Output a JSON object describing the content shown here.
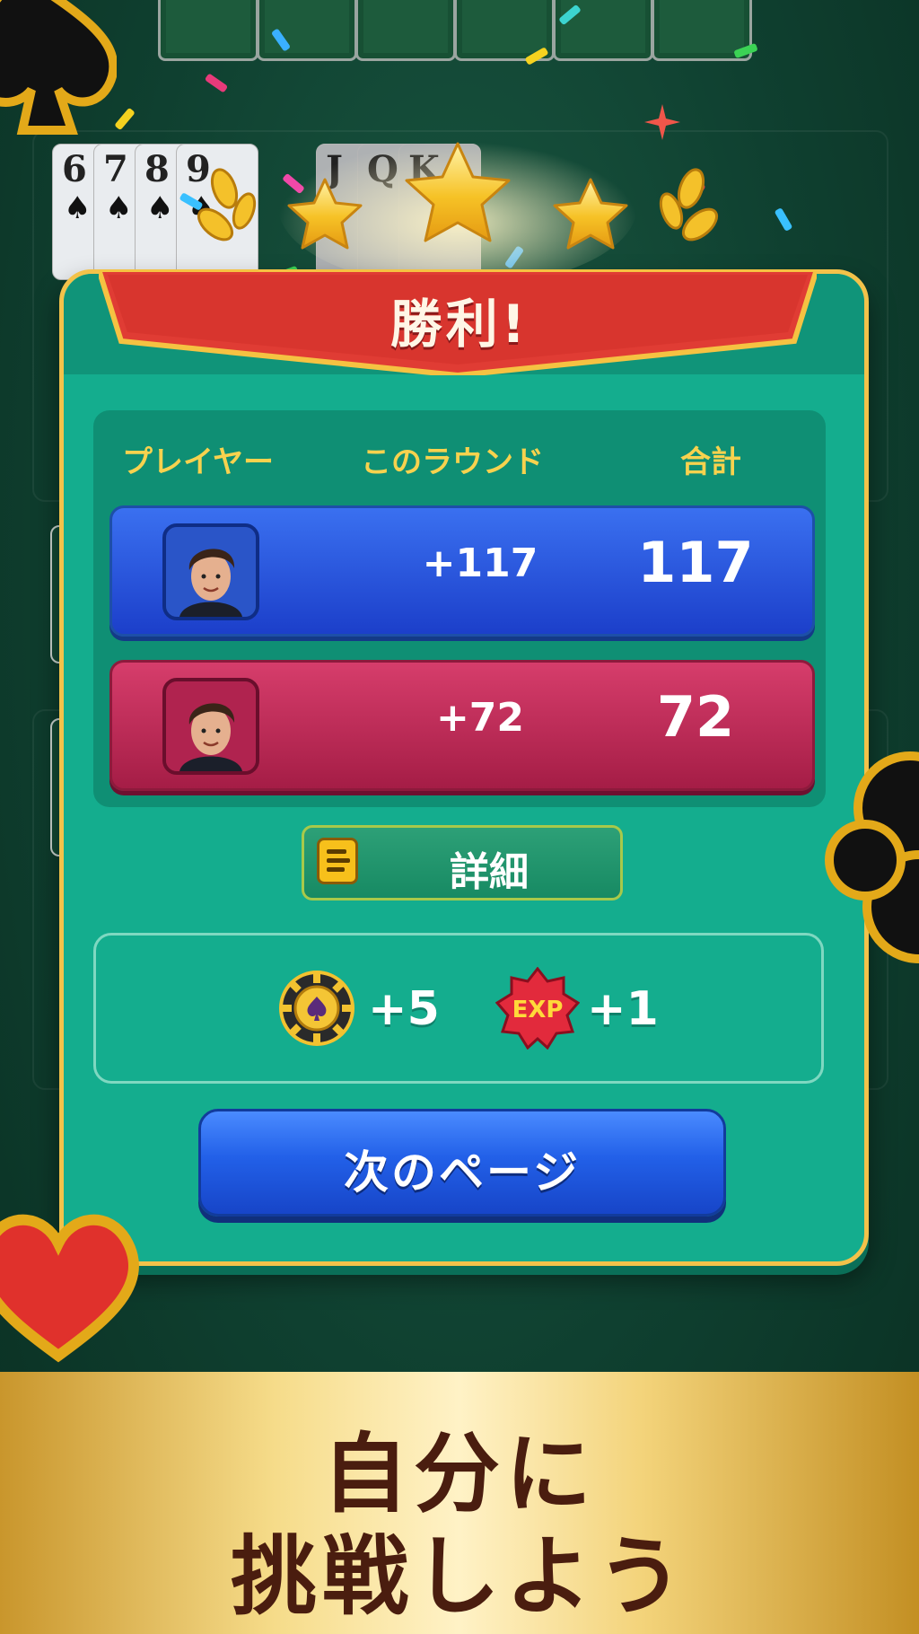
{
  "table": {
    "spade_run": [
      {
        "rank": "6",
        "suit": "♠"
      },
      {
        "rank": "7",
        "suit": "♠"
      },
      {
        "rank": "8",
        "suit": "♠"
      },
      {
        "rank": "9",
        "suit": "♠"
      }
    ],
    "face_run": [
      {
        "rank": "J"
      },
      {
        "rank": "Q"
      },
      {
        "rank": "K"
      }
    ]
  },
  "result": {
    "title": "勝利!",
    "stars_earned": 3,
    "headers": {
      "player": "プレイヤー",
      "round": "このラウンド",
      "total": "合計"
    },
    "rows": [
      {
        "color": "#2a5be0",
        "round": "+117",
        "total": "117"
      },
      {
        "color": "#c02a58",
        "round": "+72",
        "total": "72"
      }
    ],
    "details_label": "詳細",
    "rewards": {
      "chips": "+5",
      "chip_icon": "spade-chip-icon",
      "exp": "+1",
      "exp_badge": "EXP"
    },
    "next_label": "次のページ"
  },
  "banner": {
    "line1": "自分に",
    "line2": "挑戦しよう"
  }
}
